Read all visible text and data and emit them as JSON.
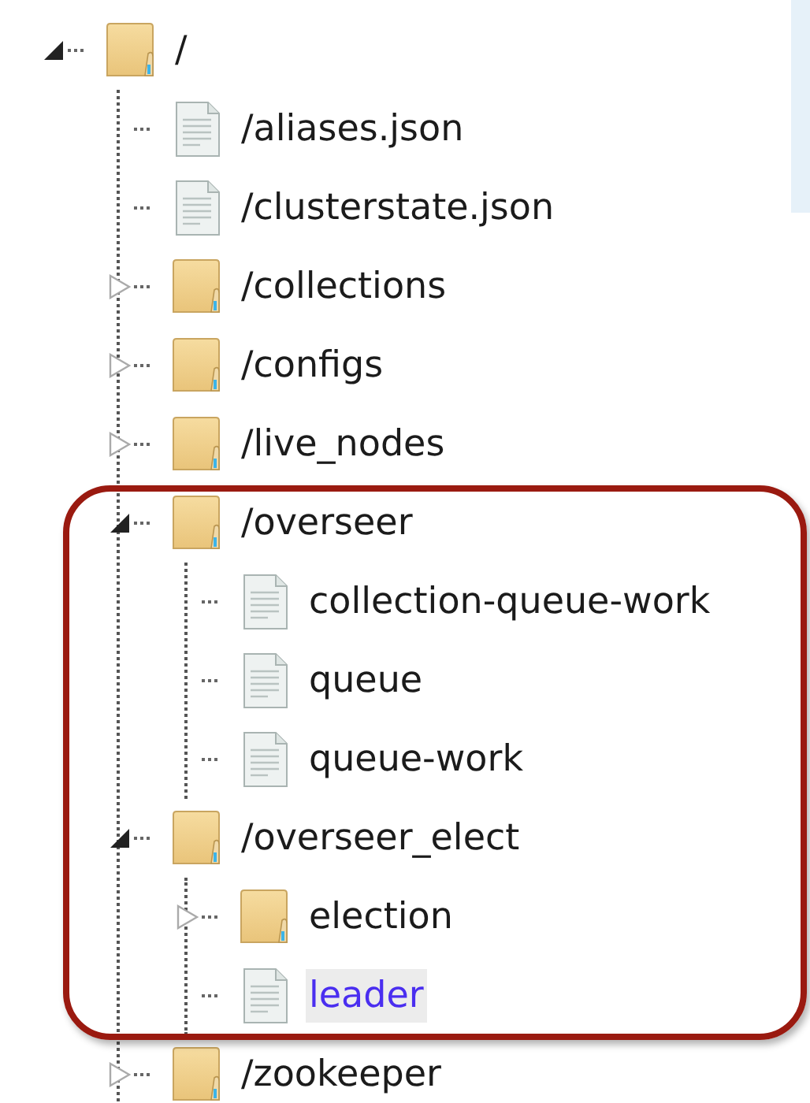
{
  "tree": {
    "kind": "folder",
    "label": "/",
    "expanded": true,
    "selected": false,
    "children": [
      {
        "kind": "file",
        "label": "/aliases.json",
        "selected": false
      },
      {
        "kind": "file",
        "label": "/clusterstate.json",
        "selected": false
      },
      {
        "kind": "folder",
        "label": "/collections",
        "expanded": false,
        "selected": false
      },
      {
        "kind": "folder",
        "label": "/configs",
        "expanded": false,
        "selected": false
      },
      {
        "kind": "folder",
        "label": "/live_nodes",
        "expanded": false,
        "selected": false
      },
      {
        "kind": "folder",
        "label": "/overseer",
        "expanded": true,
        "selected": false,
        "children": [
          {
            "kind": "file",
            "label": "collection-queue-work",
            "selected": false
          },
          {
            "kind": "file",
            "label": "queue",
            "selected": false
          },
          {
            "kind": "file",
            "label": "queue-work",
            "selected": false
          }
        ]
      },
      {
        "kind": "folder",
        "label": "/overseer_elect",
        "expanded": true,
        "selected": false,
        "children": [
          {
            "kind": "folder",
            "label": "election",
            "expanded": false,
            "selected": false
          },
          {
            "kind": "file",
            "label": "leader",
            "selected": true
          }
        ]
      },
      {
        "kind": "folder",
        "label": "/zookeeper",
        "expanded": false,
        "selected": false
      }
    ]
  }
}
